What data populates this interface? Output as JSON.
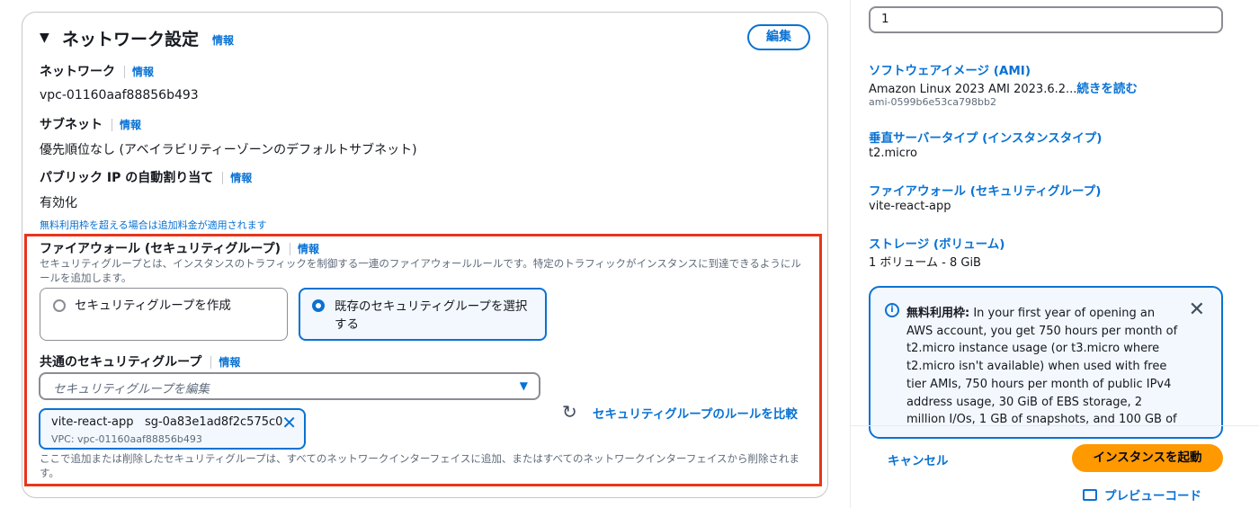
{
  "network": {
    "title": "ネットワーク設定",
    "info": "情報",
    "edit_label": "編集",
    "network_label": "ネットワーク",
    "network_value": "vpc-01160aaf88856b493",
    "subnet_label": "サブネット",
    "subnet_value": "優先順位なし (アベイラビリティーゾーンのデフォルトサブネット)",
    "public_ip_label": "パブリック IP の自動割り当て",
    "public_ip_value": "有効化",
    "free_tier_note": "無料利用枠を超える場合は追加料金が適用されます"
  },
  "firewall": {
    "label": "ファイアウォール (セキュリティグループ)",
    "info": "情報",
    "description": "セキュリティグループとは、インスタンスのトラフィックを制御する一連のファイアウォールルールです。特定のトラフィックがインスタンスに到達できるようにルールを追加します。",
    "option_create": "セキュリティグループを作成",
    "option_select_line1": "既存のセキュリティグループを選択",
    "option_select_line2": "する",
    "selected_option": "option_select",
    "common_sg_label": "共通のセキュリティグループ",
    "common_sg_info": "情報",
    "sg_placeholder": "セキュリティグループを編集",
    "token_name": "vite-react-app",
    "token_id": "sg-0a83e1ad8f2c575c0",
    "token_vpc": "VPC: vpc-01160aaf88856b493",
    "compare_label": "セキュリティグループのルールを比較",
    "footer_note": "ここで追加または削除したセキュリティグループは、すべてのネットワークインターフェイスに追加、またはすべてのネットワークインターフェイスから削除されます。"
  },
  "summary": {
    "instance_count": "1",
    "ami_label": "ソフトウェアイメージ (AMI)",
    "ami_value": "Amazon Linux 2023 AMI 2023.6.2...",
    "ami_read_more": "続きを読む",
    "ami_id": "ami-0599b6e53ca798bb2",
    "instance_type_label": "垂直サーバータイプ (インスタンスタイプ)",
    "instance_type_value": "t2.micro",
    "firewall_label": "ファイアウォール (セキュリティグループ)",
    "firewall_value": "vite-react-app",
    "storage_label": "ストレージ (ボリューム)",
    "storage_value": "1 ボリューム - 8 GiB",
    "alert_bold": "無料利用枠:",
    "alert_text": " In your first year of opening an AWS account, you get 750 hours per month of t2.micro instance usage (or t3.micro where t2.micro isn't available) when used with free tier AMIs, 750 hours per month of public IPv4 address usage, 30 GiB of EBS storage, 2 million I/Os, 1 GB of snapshots, and 100 GB of",
    "cancel_label": "キャンセル",
    "launch_label": "インスタンスを起動",
    "preview_label": "プレビューコード"
  },
  "icons": {
    "caret": "caret-down-icon",
    "refresh": "refresh-icon",
    "close": "close-icon",
    "info": "info-circle-icon",
    "code": "code-preview-icon"
  },
  "colors": {
    "link": "#0972d3",
    "highlight": "#e8351c",
    "primary_button": "#ff9900",
    "alert_bg": "#f2f8fd"
  }
}
